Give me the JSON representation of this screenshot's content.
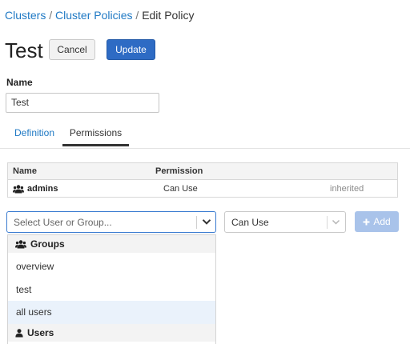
{
  "breadcrumb": {
    "item1": "Clusters",
    "sep1": " / ",
    "item2": "Cluster Policies",
    "sep2": " / ",
    "current": "Edit Policy"
  },
  "header": {
    "title": "Test",
    "cancel_label": "Cancel",
    "update_label": "Update"
  },
  "form": {
    "name_label": "Name",
    "name_value": "Test"
  },
  "tabs": [
    {
      "label": "Definition"
    },
    {
      "label": "Permissions"
    }
  ],
  "permissions_table": {
    "headers": {
      "name": "Name",
      "permission": "Permission"
    },
    "rows": [
      {
        "name": "admins",
        "permission": "Can Use",
        "note": "inherited",
        "icon": "users-icon"
      }
    ]
  },
  "add_controls": {
    "user_placeholder": "Select User or Group...",
    "permission_value": "Can Use",
    "add_label": "Add"
  },
  "dropdown": {
    "groups_header": "Groups",
    "items": [
      {
        "label": "overview"
      },
      {
        "label": "test"
      },
      {
        "label": "all users"
      }
    ],
    "users_header": "Users"
  },
  "colors": {
    "link": "#1f79c4",
    "primary": "#2e6bc4",
    "add_disabled": "#a9c3ea",
    "highlight": "#eaf2fb"
  }
}
